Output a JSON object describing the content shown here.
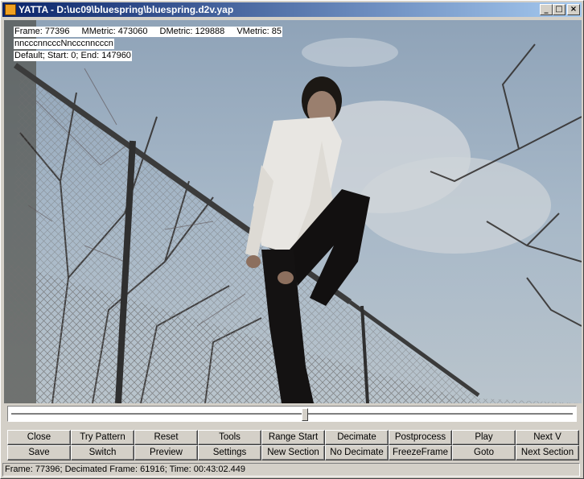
{
  "window": {
    "title": "YATTA - D:\\uc09\\bluespring\\bluespring.d2v.yap",
    "controls": {
      "minimize": "_",
      "maximize": "□",
      "close": "×"
    }
  },
  "overlay": {
    "frame": "Frame: 77396",
    "mmetric": "MMetric: 473060",
    "dmetric": "DMetric: 129888",
    "vmetric": "VMetric: 85",
    "pattern": "nncccnncccNncccnncccn",
    "section": "Default; Start: 0; End: 147960"
  },
  "slider": {
    "position": 0.523
  },
  "buttons": {
    "row1": [
      "Close",
      "Try Pattern",
      "Reset",
      "Tools",
      "Range Start",
      "Decimate",
      "Postprocess",
      "Play",
      "Next V"
    ],
    "row2": [
      "Save",
      "Switch",
      "Preview",
      "Settings",
      "New Section",
      "No Decimate",
      "FreezeFrame",
      "Goto",
      "Next Section"
    ]
  },
  "status_bar": {
    "text": "Frame: 77396; Decimated Frame: 61916; Time: 00:43:02.449"
  },
  "colors": {
    "titlebar_start": "#0a246a",
    "titlebar_end": "#a6caf0",
    "face": "#d4d0c8"
  }
}
